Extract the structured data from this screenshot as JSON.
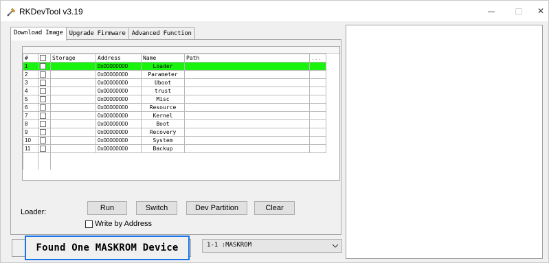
{
  "window": {
    "title": "RKDevTool v3.19",
    "controls": {
      "minimize": "—",
      "maximize": "□",
      "close": "✕"
    }
  },
  "tabs": [
    {
      "label": "Download Image",
      "active": true
    },
    {
      "label": "Upgrade Firmware",
      "active": false
    },
    {
      "label": "Advanced Function",
      "active": false
    }
  ],
  "grid": {
    "columns": [
      "#",
      "",
      "Storage",
      "Address",
      "Name",
      "Path",
      "..."
    ],
    "selected_color": "#19f40e",
    "rows": [
      {
        "num": "1",
        "address": "0x00000000",
        "name": "Loader",
        "selected": true
      },
      {
        "num": "2",
        "address": "0x00000000",
        "name": "Parameter",
        "selected": false
      },
      {
        "num": "3",
        "address": "0x00000000",
        "name": "Uboot",
        "selected": false
      },
      {
        "num": "4",
        "address": "0x00000000",
        "name": "trust",
        "selected": false
      },
      {
        "num": "5",
        "address": "0x00000000",
        "name": "Misc",
        "selected": false
      },
      {
        "num": "6",
        "address": "0x00000000",
        "name": "Resource",
        "selected": false
      },
      {
        "num": "7",
        "address": "0x00000000",
        "name": "Kernel",
        "selected": false
      },
      {
        "num": "8",
        "address": "0x00000000",
        "name": "Boot",
        "selected": false
      },
      {
        "num": "9",
        "address": "0x00000000",
        "name": "Recovery",
        "selected": false
      },
      {
        "num": "10",
        "address": "0x00000000",
        "name": "System",
        "selected": false
      },
      {
        "num": "11",
        "address": "0x00000000",
        "name": "Backup",
        "selected": false
      }
    ]
  },
  "loader": {
    "label": "Loader:",
    "run": "Run",
    "switch": "Switch",
    "dev_partition": "Dev Partition",
    "clear": "Clear",
    "write_by_address": "Write by Address"
  },
  "status": {
    "message": "Found One MASKROM Device",
    "highlight_color": "#1a73e8"
  },
  "device_select": {
    "value": "1-1 :MASKROM"
  }
}
